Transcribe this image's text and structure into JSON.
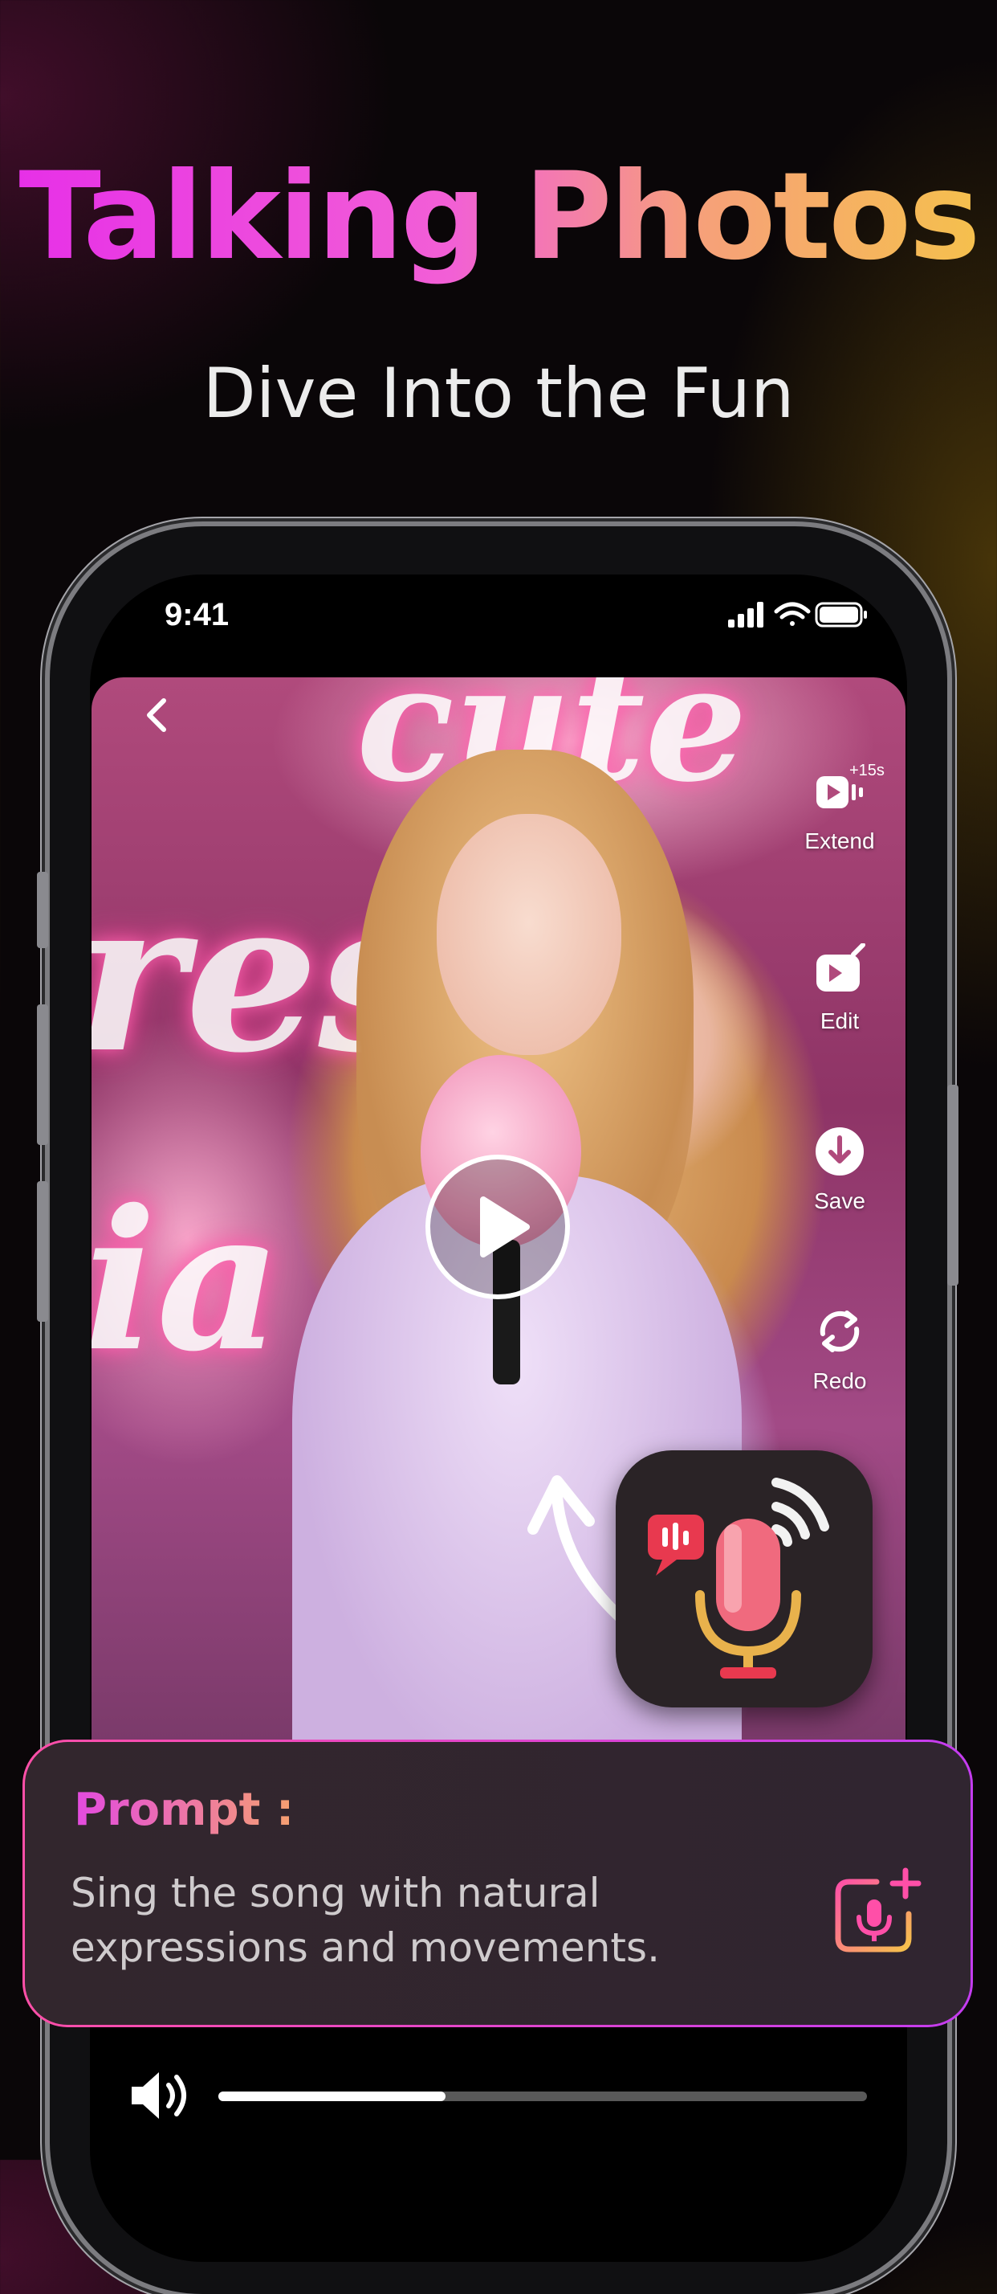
{
  "promo": {
    "title": "Talking Photos",
    "subtitle": "Dive Into the Fun"
  },
  "status_bar": {
    "time": "9:41",
    "icons": [
      "signal-icon",
      "wifi-icon",
      "battery-icon"
    ]
  },
  "video": {
    "neon_sign_text": [
      "cute",
      "ress",
      "ia"
    ],
    "actions": [
      {
        "id": "extend",
        "label": "Extend",
        "badge": "+15s",
        "icon": "extend-video-icon"
      },
      {
        "id": "edit",
        "label": "Edit",
        "icon": "edit-icon"
      },
      {
        "id": "save",
        "label": "Save",
        "icon": "download-icon"
      },
      {
        "id": "redo",
        "label": "Redo",
        "icon": "redo-icon"
      }
    ],
    "play_icon": "play-icon"
  },
  "prompt": {
    "label": "Prompt :",
    "text": "Sing the song with natural expressions and movements."
  },
  "player": {
    "progress": 0.35
  },
  "colors": {
    "title_gradient": [
      "#e62ee8",
      "#f25fd6",
      "#f6a07a",
      "#f5c24a"
    ],
    "prompt_border": [
      "#ff4fa8",
      "#c43cf0"
    ],
    "accent_pink": "#ff4fa8"
  }
}
